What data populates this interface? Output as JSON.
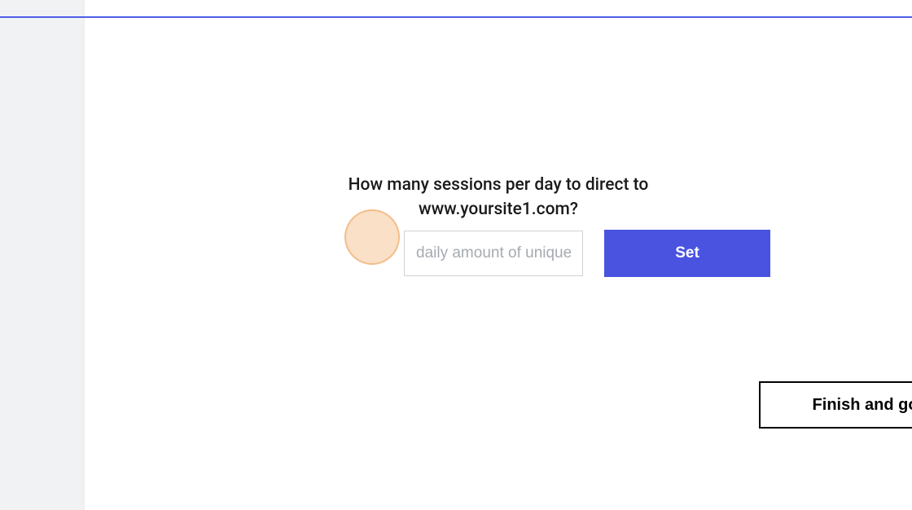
{
  "question": {
    "line1": "How many sessions per day to direct to",
    "line2": "www.yoursite1.com?"
  },
  "input": {
    "placeholder": "daily amount of unique"
  },
  "buttons": {
    "set": "Set",
    "finish": "Finish and go live"
  }
}
